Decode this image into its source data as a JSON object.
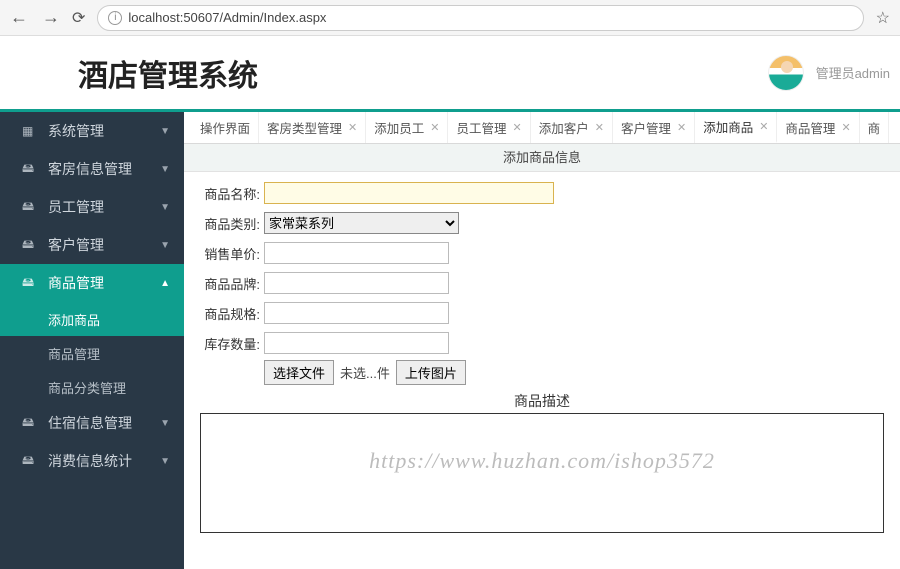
{
  "browser": {
    "url": "localhost:50607/Admin/Index.aspx"
  },
  "header": {
    "title": "酒店管理系统",
    "username": "管理员admin"
  },
  "sidebar": {
    "items": [
      {
        "icon": "▦",
        "label": "系统管理"
      },
      {
        "icon": "🖴",
        "label": "客房信息管理"
      },
      {
        "icon": "🖴",
        "label": "员工管理"
      },
      {
        "icon": "🖴",
        "label": "客户管理"
      },
      {
        "icon": "🖴",
        "label": "商品管理"
      },
      {
        "icon": "🖴",
        "label": "住宿信息管理"
      },
      {
        "icon": "🖴",
        "label": "消费信息统计"
      }
    ],
    "product_submenu": [
      {
        "label": "添加商品"
      },
      {
        "label": "商品管理"
      },
      {
        "label": "商品分类管理"
      }
    ]
  },
  "tabs": [
    {
      "label": "操作界面",
      "closable": false
    },
    {
      "label": "客房类型管理",
      "closable": true
    },
    {
      "label": "添加员工",
      "closable": true
    },
    {
      "label": "员工管理",
      "closable": true
    },
    {
      "label": "添加客户",
      "closable": true
    },
    {
      "label": "客户管理",
      "closable": true
    },
    {
      "label": "添加商品",
      "closable": true,
      "active": true
    },
    {
      "label": "商品管理",
      "closable": true
    },
    {
      "label": "商",
      "closable": false
    }
  ],
  "form": {
    "section_title": "添加商品信息",
    "fields": {
      "name_label": "商品名称:",
      "category_label": "商品类别:",
      "category_value": "家常菜系列",
      "price_label": "销售单价:",
      "brand_label": "商品品牌:",
      "spec_label": "商品规格:",
      "stock_label": "库存数量:"
    },
    "file_button": "选择文件",
    "file_status": "未选...件",
    "upload_button": "上传图片",
    "desc_title": "商品描述"
  },
  "watermark": "https://www.huzhan.com/ishop3572"
}
